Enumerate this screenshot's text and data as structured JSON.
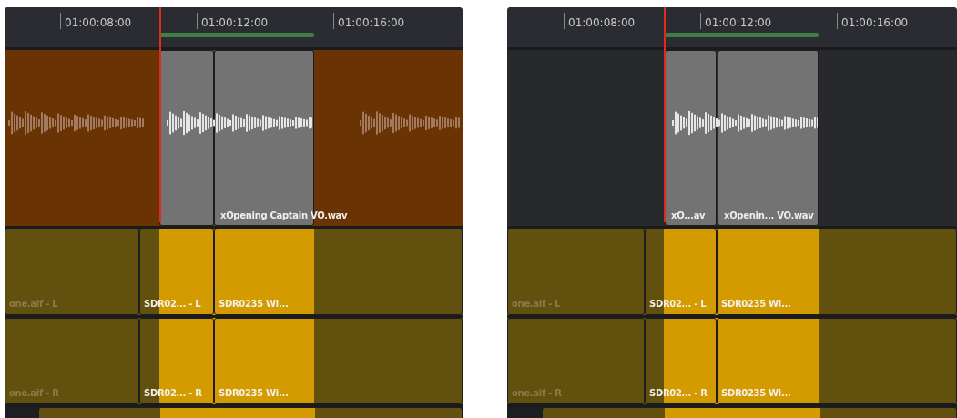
{
  "panels": [
    {
      "ruler": {
        "timecodes": [
          "01:00:08:00",
          "01:00:12:00",
          "01:00:16:00"
        ]
      },
      "video_track": {
        "clips": [
          {
            "label": "xOpening Captain VO.wav"
          }
        ]
      },
      "audio_tracks": [
        {
          "clips": [
            {
              "label": "one.aif - L"
            },
            {
              "label": "SDR02...  - L"
            },
            {
              "label": "SDR0235 Wi..."
            }
          ]
        },
        {
          "clips": [
            {
              "label": "one.aif - R"
            },
            {
              "label": "SDR02...  - R"
            },
            {
              "label": "SDR0235 Wi..."
            }
          ]
        }
      ]
    },
    {
      "ruler": {
        "timecodes": [
          "01:00:08:00",
          "01:00:12:00",
          "01:00:16:00"
        ]
      },
      "video_track": {
        "clips": [
          {
            "label": "xO...av"
          },
          {
            "label": "xOpenin... VO.wav"
          }
        ]
      },
      "audio_tracks": [
        {
          "clips": [
            {
              "label": "one.aif - L"
            },
            {
              "label": "SDR02...  - L"
            },
            {
              "label": "SDR0235 Wi..."
            }
          ]
        },
        {
          "clips": [
            {
              "label": "one.aif - R"
            },
            {
              "label": "SDR02...  - R"
            },
            {
              "label": "SDR0235 Wi..."
            }
          ]
        }
      ]
    }
  ]
}
